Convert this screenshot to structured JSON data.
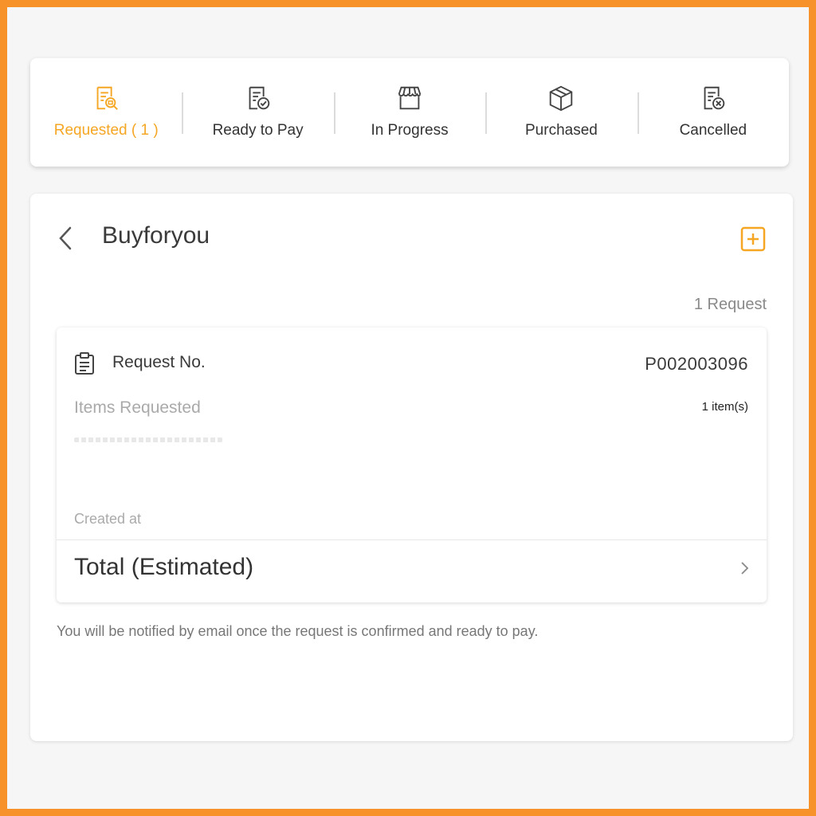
{
  "tabs": [
    {
      "label": "Requested ( 1 )",
      "icon": "request-search-icon",
      "active": true
    },
    {
      "label": "Ready to Pay",
      "icon": "document-check-icon",
      "active": false
    },
    {
      "label": "In Progress",
      "icon": "storefront-icon",
      "active": false
    },
    {
      "label": "Purchased",
      "icon": "package-box-icon",
      "active": false
    },
    {
      "label": "Cancelled",
      "icon": "document-cancel-icon",
      "active": false
    }
  ],
  "header": {
    "title": "Buyforyou",
    "back_icon": "chevron-left-icon",
    "add_icon": "add-square-icon"
  },
  "request_count": "1 Request",
  "request": {
    "no_label": "Request No.",
    "no_value": "P002003096",
    "items_label": "Items Requested",
    "items_count": "1 item(s)",
    "created_label": "Created at",
    "total_label": "Total (Estimated)"
  },
  "notice": "You will be notified by email once the request is confirmed and ready to pay.",
  "colors": {
    "accent": "#f5a623",
    "frame": "#f7922a",
    "text_primary": "#333333",
    "text_muted": "#aaaaaa"
  }
}
